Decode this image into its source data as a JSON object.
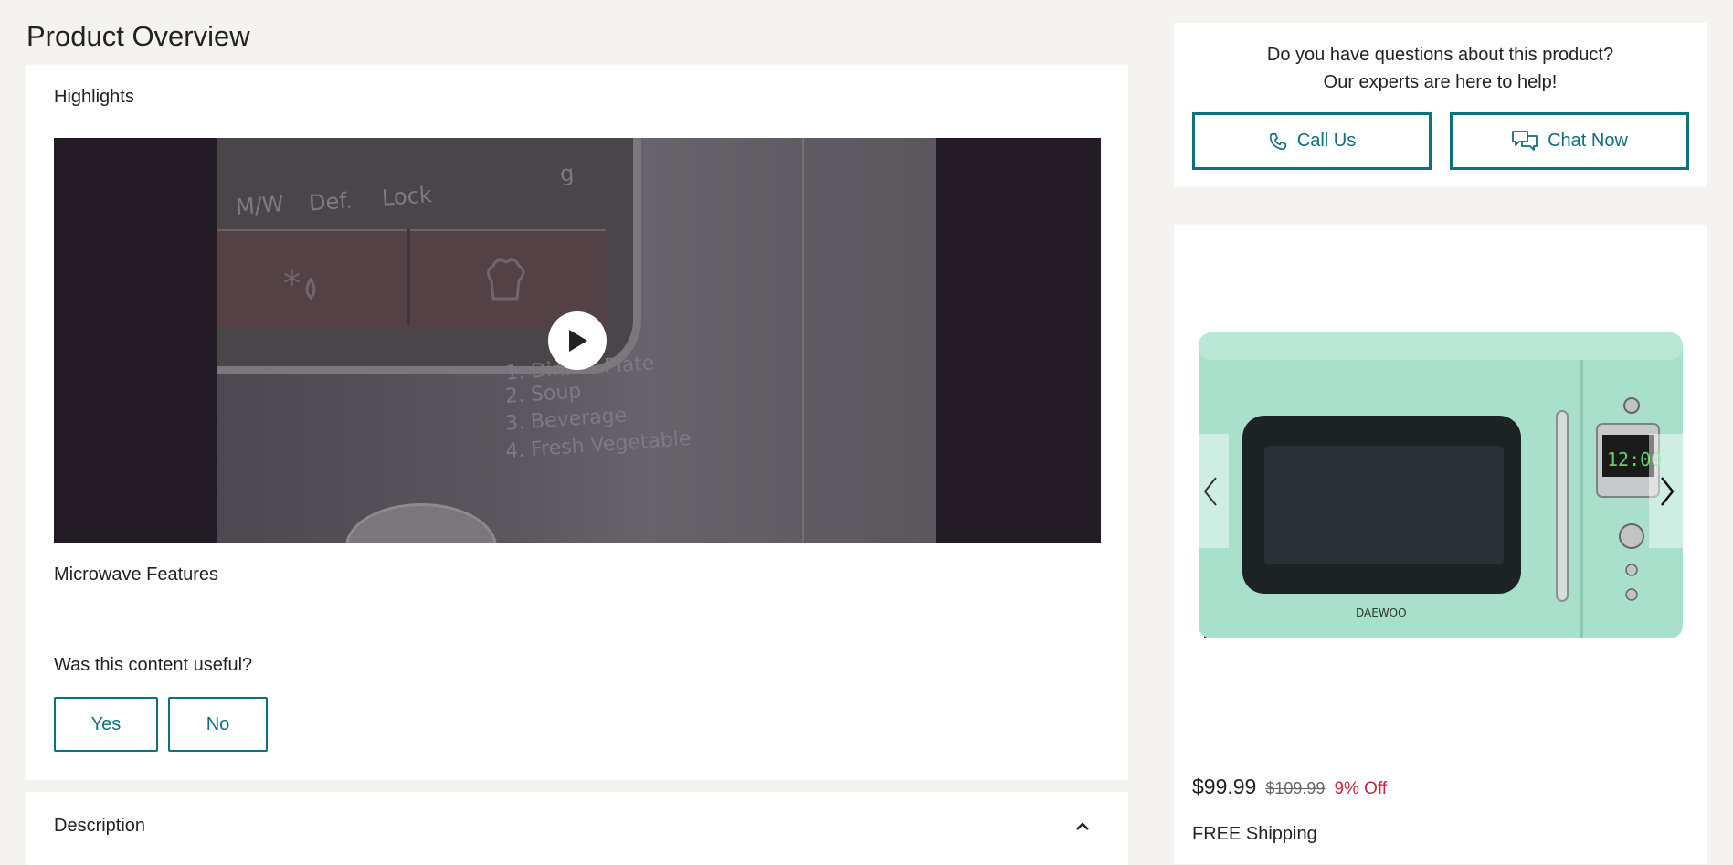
{
  "overview": {
    "title": "Product Overview",
    "highlights_label": "Highlights",
    "video": {
      "frame_texts": [
        "M/W",
        "Def.",
        "Lock",
        "g",
        "1. Dinner Plate",
        "2. Soup",
        "3. Beverage",
        "4. Fresh Vegetable"
      ]
    },
    "features_label": "Microwave Features",
    "feedback": {
      "question": "Was this content useful?",
      "yes_label": "Yes",
      "no_label": "No"
    },
    "description_label": "Description"
  },
  "help": {
    "line1": "Do you have questions about this product?",
    "line2": "Our experts are here to help!",
    "call_label": "Call Us",
    "chat_label": "Chat Now"
  },
  "product": {
    "brand_on_image": "DAEWOO",
    "display_time": "12:00",
    "price_current": "$99.99",
    "price_original": "$109.99",
    "discount": "9% Off",
    "shipping": "FREE Shipping"
  },
  "colors": {
    "accent": "#0e6f7e",
    "page_background": "#f4f3ef",
    "discount_red": "#c5283d",
    "video_background": "#221a24",
    "microwave_mint": "#a8e0cc"
  }
}
